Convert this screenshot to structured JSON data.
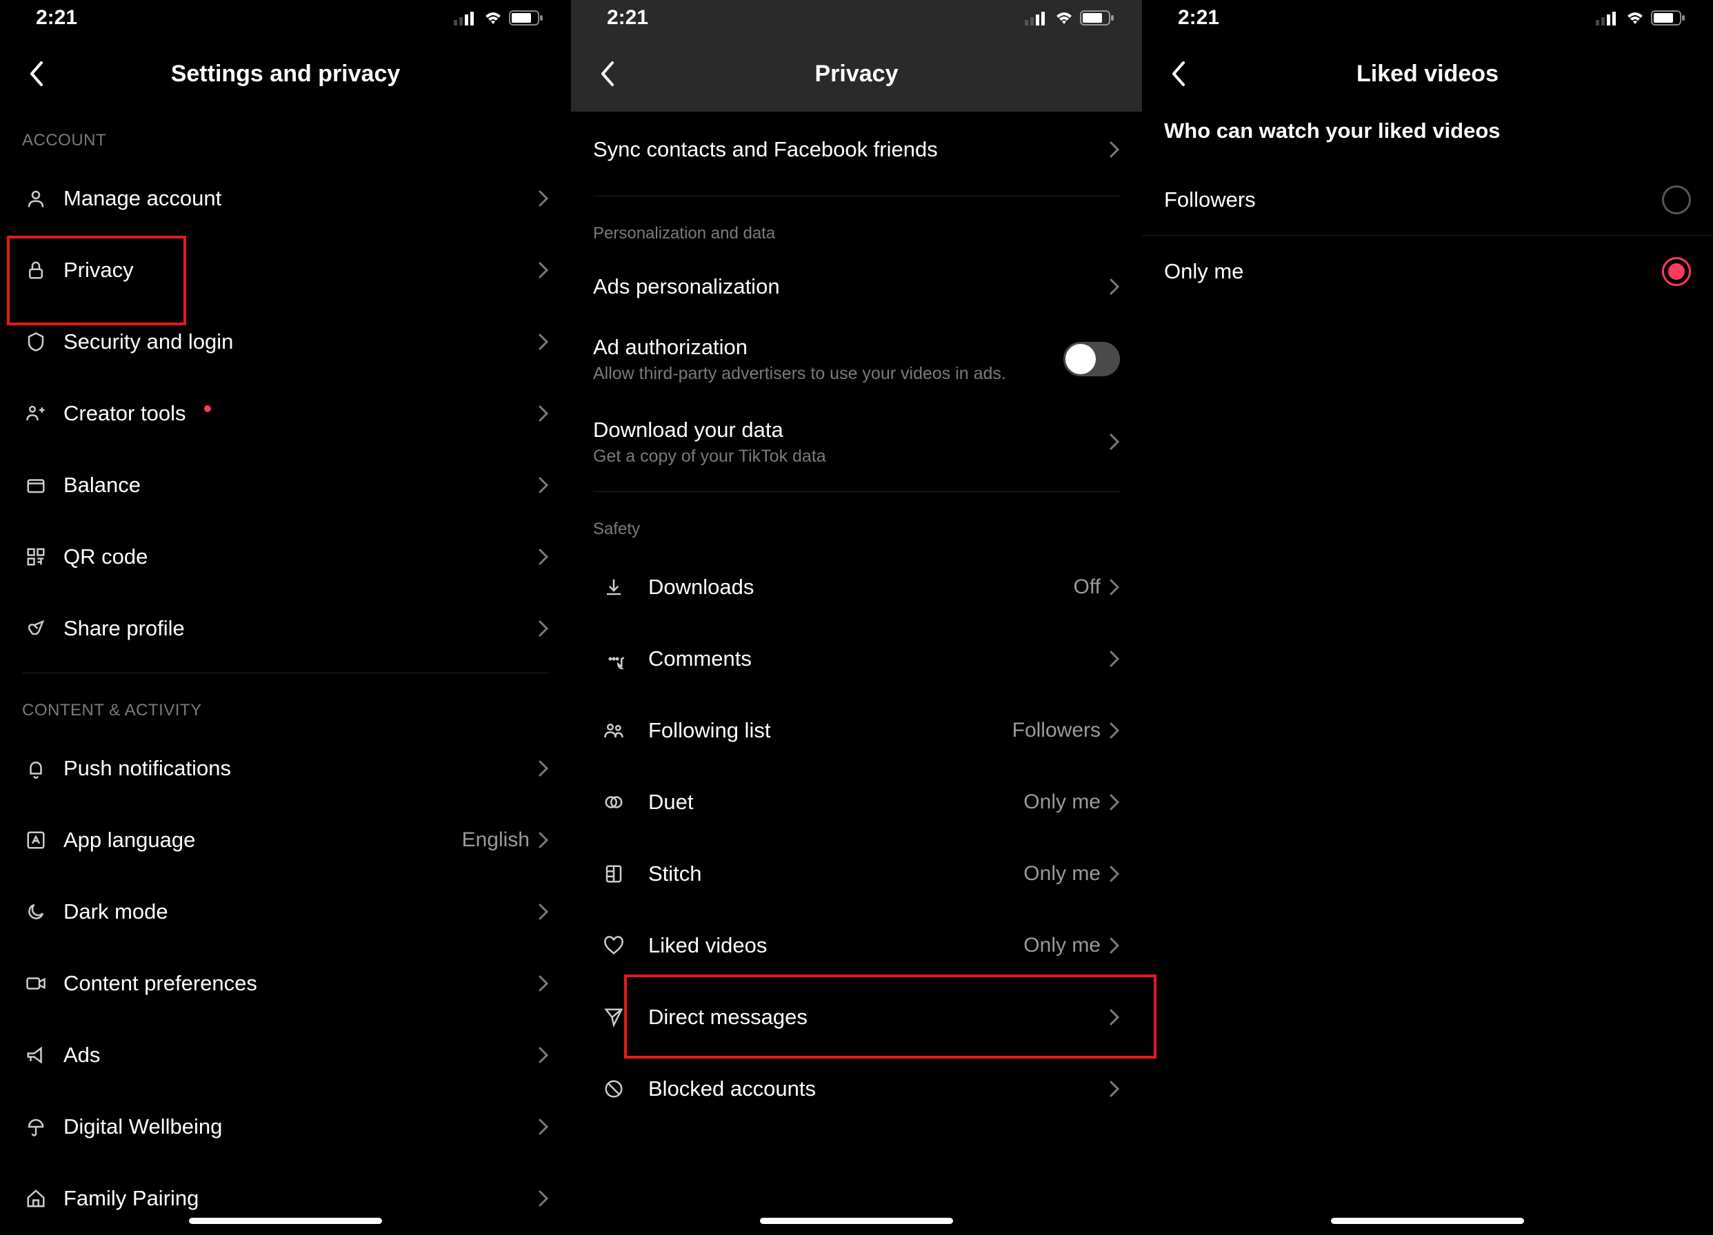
{
  "status": {
    "time": "2:21"
  },
  "screen1": {
    "title": "Settings and privacy",
    "sections": {
      "account": {
        "header": "ACCOUNT",
        "items": {
          "manage": "Manage account",
          "privacy": "Privacy",
          "security": "Security and login",
          "creator": "Creator tools",
          "balance": "Balance",
          "qr": "QR code",
          "share": "Share profile"
        }
      },
      "content": {
        "header": "CONTENT & ACTIVITY",
        "items": {
          "push": "Push notifications",
          "lang": "App language",
          "lang_value": "English",
          "dark": "Dark mode",
          "pref": "Content preferences",
          "ads": "Ads",
          "wellbeing": "Digital Wellbeing",
          "family": "Family Pairing"
        }
      }
    }
  },
  "screen2": {
    "title": "Privacy",
    "items": {
      "sync": "Sync contacts and Facebook friends",
      "personalization_header": "Personalization and data",
      "ads_personalization": "Ads personalization",
      "ad_auth": "Ad authorization",
      "ad_auth_sub": "Allow third-party advertisers to use your videos in ads.",
      "download_data": "Download your data",
      "download_data_sub": "Get a copy of your TikTok data",
      "safety_header": "Safety",
      "downloads": "Downloads",
      "downloads_value": "Off",
      "comments": "Comments",
      "following": "Following list",
      "following_value": "Followers",
      "duet": "Duet",
      "duet_value": "Only me",
      "stitch": "Stitch",
      "stitch_value": "Only me",
      "liked": "Liked videos",
      "liked_value": "Only me",
      "dm": "Direct messages",
      "blocked": "Blocked accounts"
    }
  },
  "screen3": {
    "title": "Liked videos",
    "question": "Who can watch your liked videos",
    "options": {
      "followers": "Followers",
      "only_me": "Only me"
    },
    "selected": "only_me"
  }
}
